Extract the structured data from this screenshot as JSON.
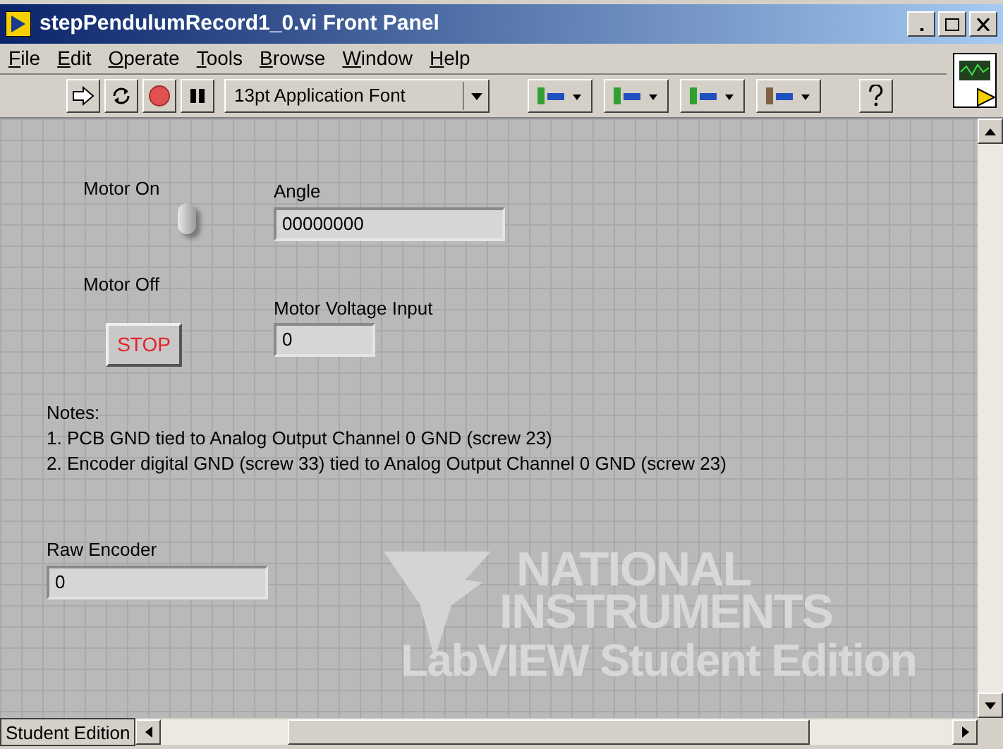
{
  "window": {
    "title": "stepPendulumRecord1_0.vi Front Panel"
  },
  "menu": [
    "File",
    "Edit",
    "Operate",
    "Tools",
    "Browse",
    "Window",
    "Help"
  ],
  "toolbar": {
    "font": "13pt Application Font"
  },
  "switch": {
    "on_label": "Motor On",
    "off_label": "Motor Off",
    "on": true
  },
  "stop_button": {
    "label": "STOP"
  },
  "indicators": [
    {
      "label": "Angle",
      "value": "00000000"
    },
    {
      "label": "Motor Voltage Input",
      "value": "0"
    },
    {
      "label": "Raw Encoder",
      "value": "0"
    }
  ],
  "notes": [
    "Notes:",
    "1. PCB GND tied to Analog Output Channel 0 GND (screw 23)",
    "2. Encoder digital GND (screw 33) tied to Analog Output Channel 0 GND (screw 23)"
  ],
  "student_mark": {
    "line_1": "NATIONAL",
    "line_2": "INSTRUMENTS",
    "line_3": "LabVIEW Student Edition"
  },
  "status_bar": {
    "tab": "Student Edition"
  }
}
